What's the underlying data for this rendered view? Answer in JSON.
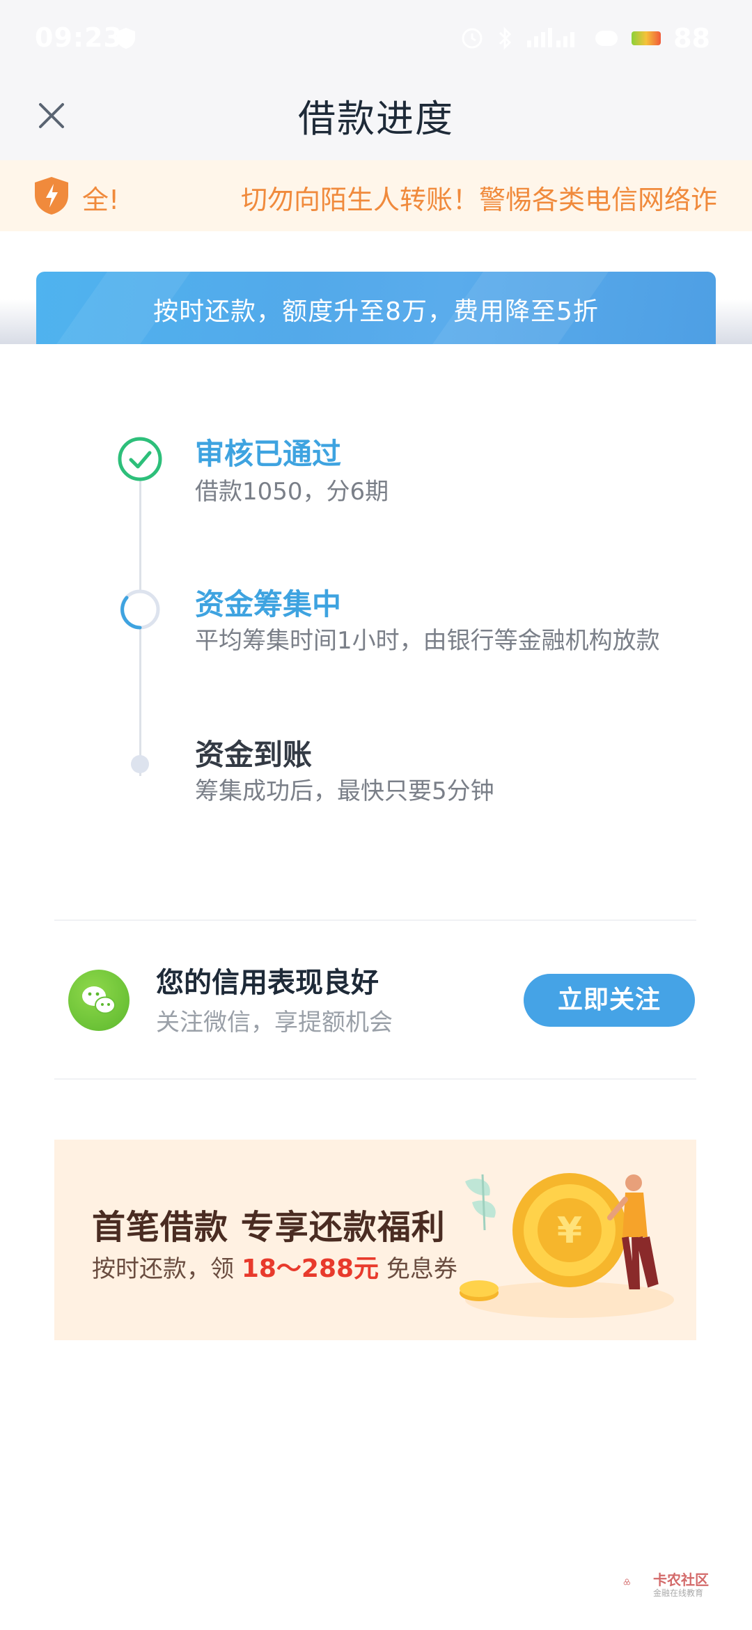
{
  "status_bar": {
    "time": "09:23",
    "battery": "88"
  },
  "header": {
    "title": "借款进度"
  },
  "warning": {
    "prefix": "全!",
    "message": "切勿向陌生人转账！警惕各类电信网络诈"
  },
  "promo": {
    "text": "按时还款，额度升至8万，费用降至5折"
  },
  "steps": [
    {
      "title": "审核已通过",
      "desc": "借款1050，分6期",
      "state": "done"
    },
    {
      "title": "资金筹集中",
      "desc": "平均筹集时间1小时，由银行等金融机构放款",
      "state": "in-progress"
    },
    {
      "title": "资金到账",
      "desc": "筹集成功后，最快只要5分钟",
      "state": "pending"
    }
  ],
  "follow_card": {
    "title": "您的信用表现良好",
    "subtitle": "关注微信，享提额机会",
    "button": "立即关注"
  },
  "bonus_banner": {
    "title": "首笔借款 专享还款福利",
    "sub_prefix": "按时还款，领",
    "sub_amount": "18～288元",
    "sub_suffix": "免息券"
  },
  "watermark": {
    "name": "卡农社区",
    "tagline": "金融在线教育"
  },
  "colors": {
    "accent_blue": "#3ea3e0",
    "warning_orange": "#f08a3c",
    "success_green": "#2dbf7a",
    "wechat_green": "#5cb82e"
  }
}
